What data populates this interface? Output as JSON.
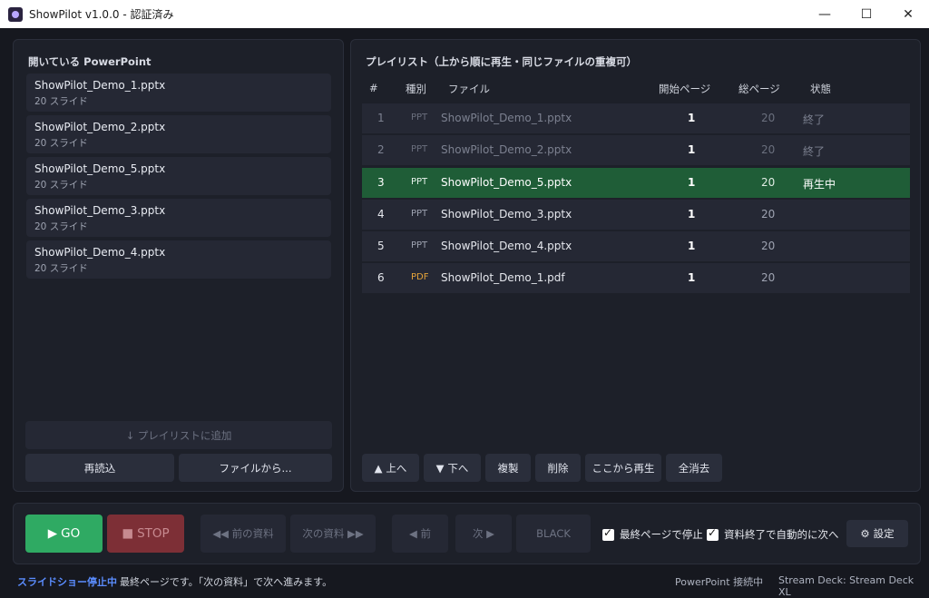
{
  "window": {
    "title": "ShowPilot v1.0.0 - 認証済み",
    "minimize": "—",
    "maximize": "☐",
    "close": "✕"
  },
  "left": {
    "title": "開いている PowerPoint",
    "items": [
      {
        "name": "ShowPilot_Demo_1.pptx",
        "count": "20 スライド"
      },
      {
        "name": "ShowPilot_Demo_2.pptx",
        "count": "20 スライド"
      },
      {
        "name": "ShowPilot_Demo_5.pptx",
        "count": "20 スライド"
      },
      {
        "name": "ShowPilot_Demo_3.pptx",
        "count": "20 スライド"
      },
      {
        "name": "ShowPilot_Demo_4.pptx",
        "count": "20 スライド"
      }
    ],
    "add_label": "↓ プレイリストに追加",
    "reload_label": "再読込",
    "from_file_label": "ファイルから..."
  },
  "playlist": {
    "title": "プレイリスト（上から順に再生・同じファイルの重複可）",
    "headers": {
      "num": "#",
      "kind": "種別",
      "file": "ファイル",
      "start": "開始ページ",
      "total": "総ページ",
      "state": "状態"
    },
    "rows": [
      {
        "num": "1",
        "kind": "PPT",
        "file": "ShowPilot_Demo_1.pptx",
        "start": "1",
        "total": "20",
        "state": "終了"
      },
      {
        "num": "2",
        "kind": "PPT",
        "file": "ShowPilot_Demo_2.pptx",
        "start": "1",
        "total": "20",
        "state": "終了"
      },
      {
        "num": "3",
        "kind": "PPT",
        "file": "ShowPilot_Demo_5.pptx",
        "start": "1",
        "total": "20",
        "state": "再生中"
      },
      {
        "num": "4",
        "kind": "PPT",
        "file": "ShowPilot_Demo_3.pptx",
        "start": "1",
        "total": "20",
        "state": ""
      },
      {
        "num": "5",
        "kind": "PPT",
        "file": "ShowPilot_Demo_4.pptx",
        "start": "1",
        "total": "20",
        "state": ""
      },
      {
        "num": "6",
        "kind": "PDF",
        "file": "ShowPilot_Demo_1.pdf",
        "start": "1",
        "total": "20",
        "state": ""
      }
    ],
    "buttons": {
      "up": "上へ",
      "down": "下へ",
      "duplicate": "複製",
      "delete": "削除",
      "play_from_here": "ここから再生",
      "clear_all": "全消去"
    }
  },
  "controls": {
    "go": "GO",
    "stop": "STOP",
    "prev_doc": "◀◀ 前の資料",
    "next_doc": "次の資料 ▶▶",
    "prev": "◀ 前",
    "next": "次 ▶",
    "black": "BLACK",
    "stop_at_last": "最終ページで停止",
    "auto_next": "資料終了で自動的に次へ",
    "settings": "設定"
  },
  "status": {
    "state": "スライドショー停止中",
    "message": "最終ページです。「次の資料」で次へ進みます。",
    "powerpoint": "PowerPoint 接続中",
    "stream_deck": "Stream Deck: Stream Deck XL"
  },
  "colors": {
    "active_row": "#1f5d37",
    "go": "#2faa63",
    "stop": "#7d2f36",
    "status_state": "#5b8dff",
    "pdf_kind": "#e5a43a"
  }
}
